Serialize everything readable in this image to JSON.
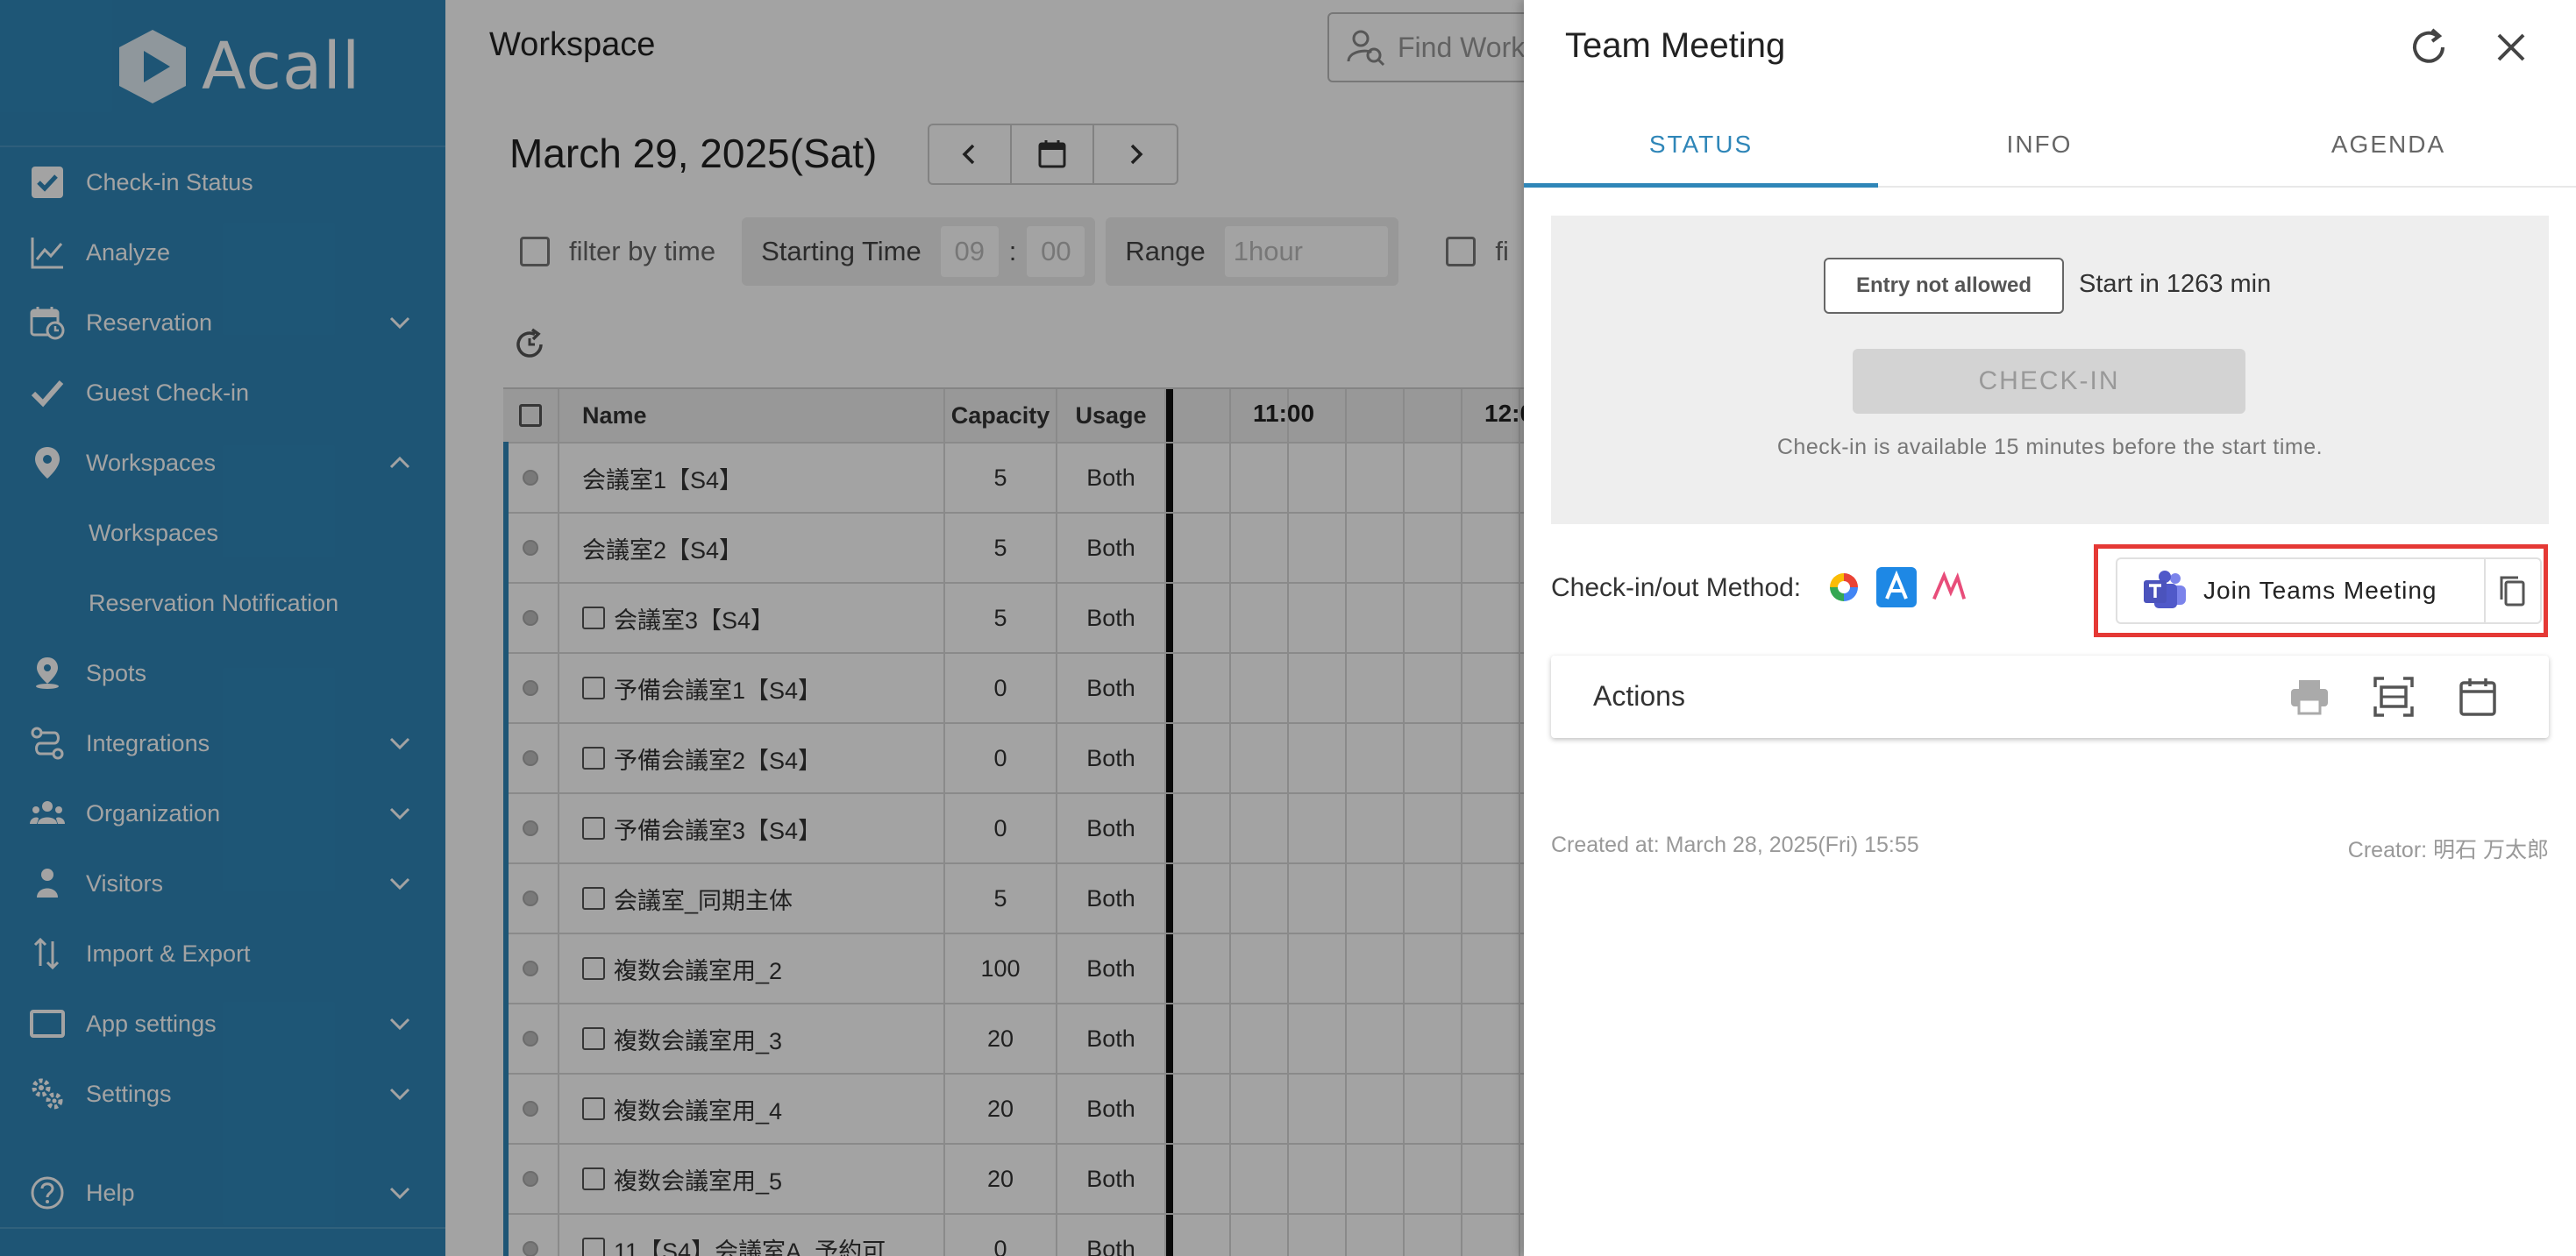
{
  "brand": {
    "name": "Acall"
  },
  "sidebar": {
    "items": [
      {
        "label": "Check-in Status",
        "icon": "checkbox-icon",
        "expandable": false
      },
      {
        "label": "Analyze",
        "icon": "chart-line-icon",
        "expandable": false
      },
      {
        "label": "Reservation",
        "icon": "calendar-clock-icon",
        "expandable": true
      },
      {
        "label": "Guest Check-in",
        "icon": "check-icon",
        "expandable": false
      },
      {
        "label": "Workspaces",
        "icon": "map-pin-icon",
        "expandable": true,
        "expanded": true
      }
    ],
    "sub_items": [
      {
        "label": "Workspaces"
      },
      {
        "label": "Reservation Notification"
      }
    ],
    "items_after": [
      {
        "label": "Spots",
        "icon": "spot-pin-icon",
        "expandable": false
      },
      {
        "label": "Integrations",
        "icon": "integrations-icon",
        "expandable": true
      },
      {
        "label": "Organization",
        "icon": "people-icon",
        "expandable": true
      },
      {
        "label": "Visitors",
        "icon": "visitor-icon",
        "expandable": true
      },
      {
        "label": "Import & Export",
        "icon": "import-export-icon",
        "expandable": false
      },
      {
        "label": "App settings",
        "icon": "app-window-icon",
        "expandable": true
      },
      {
        "label": "Settings",
        "icon": "gears-icon",
        "expandable": true
      }
    ],
    "help": {
      "label": "Help",
      "icon": "help-circle-icon"
    }
  },
  "main": {
    "title": "Workspace",
    "search_placeholder": "Find Work",
    "date": "March 29, 2025(Sat)",
    "filter": {
      "filter_by_time": "filter by time",
      "starting_time_label": "Starting Time",
      "hour": "09",
      "colon": ":",
      "minute": "00",
      "range_label": "Range",
      "range_value": "1hour",
      "second_filter_partial": "fi"
    },
    "table": {
      "headers": {
        "name": "Name",
        "capacity": "Capacity",
        "usage": "Usage"
      },
      "time_headers": [
        "11:00",
        "12:0"
      ],
      "rows": [
        {
          "name": "会議室1【S4】",
          "capacity": "5",
          "usage": "Both",
          "checkbox": false
        },
        {
          "name": "会議室2【S4】",
          "capacity": "5",
          "usage": "Both",
          "checkbox": false
        },
        {
          "name": "会議室3【S4】",
          "capacity": "5",
          "usage": "Both",
          "checkbox": true
        },
        {
          "name": "予備会議室1【S4】",
          "capacity": "0",
          "usage": "Both",
          "checkbox": true
        },
        {
          "name": "予備会議室2【S4】",
          "capacity": "0",
          "usage": "Both",
          "checkbox": true
        },
        {
          "name": "予備会議室3【S4】",
          "capacity": "0",
          "usage": "Both",
          "checkbox": true
        },
        {
          "name": "会議室_同期主体",
          "capacity": "5",
          "usage": "Both",
          "checkbox": true
        },
        {
          "name": "複数会議室用_2",
          "capacity": "100",
          "usage": "Both",
          "checkbox": true
        },
        {
          "name": "複数会議室用_3",
          "capacity": "20",
          "usage": "Both",
          "checkbox": true
        },
        {
          "name": "複数会議室用_4",
          "capacity": "20",
          "usage": "Both",
          "checkbox": true
        },
        {
          "name": "複数会議室用_5",
          "capacity": "20",
          "usage": "Both",
          "checkbox": true
        },
        {
          "name": "11【S4】会議室A_予約可...",
          "capacity": "0",
          "usage": "Both",
          "checkbox": true
        }
      ]
    }
  },
  "panel": {
    "title": "Team Meeting",
    "tabs": [
      {
        "label": "STATUS",
        "active": true
      },
      {
        "label": "INFO",
        "active": false
      },
      {
        "label": "AGENDA",
        "active": false
      }
    ],
    "status": {
      "badge": "Entry not allowed",
      "start_in": "Start in 1263 min",
      "checkin_label": "CHECK-IN",
      "note": "Check-in is available 15 minutes before the start time."
    },
    "method_label": "Check-in/out Method:",
    "join_label": "Join Teams Meeting",
    "actions_label": "Actions",
    "created": "Created at: March 28, 2025(Fri) 15:55",
    "creator": "Creator: 明石 万太郎"
  },
  "colors": {
    "sidebar_bg": "#2f86b8",
    "accent": "#2f86b8",
    "highlight_border": "#e53935",
    "teams_purple": "#5059c9"
  }
}
